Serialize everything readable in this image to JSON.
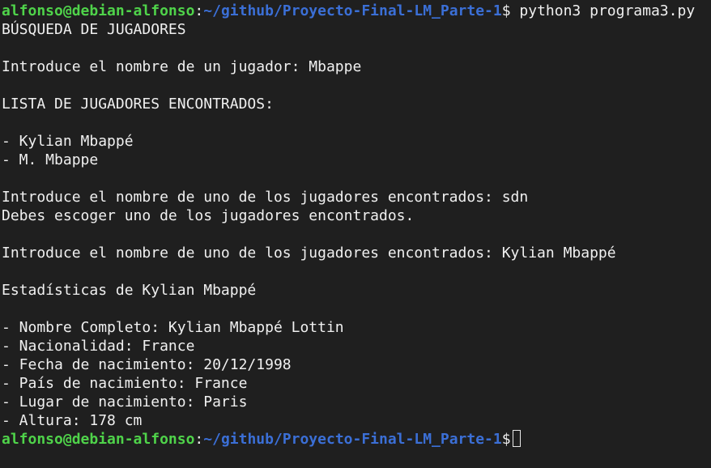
{
  "prompt": {
    "user_host": "alfonso@debian-alfonso",
    "separator": ":",
    "path": "~/github/Proyecto-Final-LM_Parte-1",
    "symbol": "$"
  },
  "command": " python3 programa3.py",
  "output": {
    "header": "BÚSQUEDA DE JUGADORES",
    "query_prompt": "Introduce el nombre de un jugador: Mbappe",
    "list_header": "LISTA DE JUGADORES ENCONTRADOS:",
    "results": [
      "- Kylian Mbappé",
      "- M. Mbappe"
    ],
    "choose_prompt_1": "Introduce el nombre de uno de los jugadores encontrados: sdn",
    "error_msg": "Debes escoger uno de los jugadores encontrados.",
    "choose_prompt_2": "Introduce el nombre de uno de los jugadores encontrados: Kylian Mbappé",
    "stats_header": "Estadísticas de Kylian Mbappé",
    "stats": [
      "- Nombre Completo: Kylian Mbappé Lottin",
      "- Nacionalidad: France",
      "- Fecha de nacimiento: 20/12/1998",
      "- País de nacimiento: France",
      "- Lugar de nacimiento: Paris",
      "- Altura: 178 cm"
    ]
  },
  "colors": {
    "background": "#1f1f1f",
    "text": "#f0f0f0",
    "user_host": "#4fd34a",
    "path": "#3b6fd6"
  }
}
